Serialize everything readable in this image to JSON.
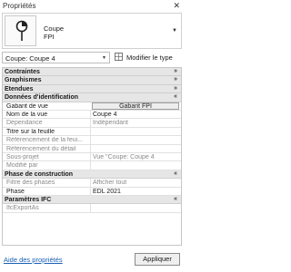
{
  "window": {
    "title": "Propriétés",
    "close_icon": "close-icon"
  },
  "type_selector": {
    "family": "Coupe",
    "type": "FPI",
    "thumbnail_icon": "section-view-icon"
  },
  "instance": {
    "selected_view": "Coupe: Coupe 4",
    "edit_type_label": "Modifier le type"
  },
  "categories": {
    "contraintes": "Contraintes",
    "graphismes": "Graphismes",
    "etendues": "Etendues",
    "donnees": "Données d'identification",
    "phase": "Phase de construction",
    "ifc": "Paramètres IFC"
  },
  "identity": {
    "gabarit": {
      "name": "Gabarit de vue",
      "value": "Gabarit FPI"
    },
    "nom": {
      "name": "Nom de la vue",
      "value": "Coupe 4"
    },
    "dependance": {
      "name": "Dépendance",
      "value": "Indépendant"
    },
    "titre": {
      "name": "Titre sur la feuille",
      "value": ""
    },
    "ref_feuille": {
      "name": "Référencement de la feui...",
      "value": ""
    },
    "ref_detail": {
      "name": "Référencement du détail",
      "value": ""
    },
    "sous_projet": {
      "name": "Sous-projet",
      "value": "Vue \"Coupe: Coupe 4"
    },
    "modifie_par": {
      "name": "Modifié par",
      "value": ""
    }
  },
  "phasing": {
    "filtre": {
      "name": "Filtre des phases",
      "value": "Afficher tout"
    },
    "phase": {
      "name": "Phase",
      "value": "EDL 2021"
    }
  },
  "ifc": {
    "export": {
      "name": "IfcExportAs",
      "value": ""
    }
  },
  "footer": {
    "help_link": "Aide des propriétés",
    "apply_label": "Appliquer"
  }
}
